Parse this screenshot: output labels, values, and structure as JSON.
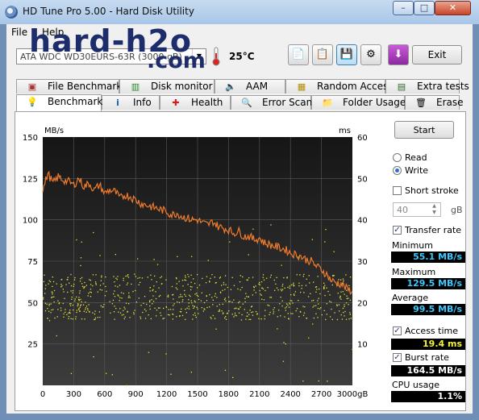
{
  "window": {
    "title": "HD Tune Pro 5.00 - Hard Disk Utility",
    "min_label": "–",
    "max_label": "□",
    "close_label": "✕"
  },
  "menu": {
    "file": "File",
    "help": "Help"
  },
  "watermark": {
    "line1": "hard-h2o",
    "line2": ".com"
  },
  "toolbar": {
    "drive": "ATA    WDC WD30EURS-63R (3000 gB)",
    "temperature": "25°C",
    "exit_label": "Exit",
    "icons": [
      "copy-icon",
      "copy-info-icon",
      "save-icon",
      "options-icon",
      "download-icon"
    ]
  },
  "tabs_top": [
    "File Benchmark",
    "Disk monitor",
    "AAM",
    "Random Access",
    "Extra tests"
  ],
  "tabs_bottom": [
    "Benchmark",
    "Info",
    "Health",
    "Error Scan",
    "Folder Usage",
    "Erase"
  ],
  "side": {
    "start_label": "Start",
    "read_label": "Read",
    "write_label": "Write",
    "mode_selected": "Write",
    "short_stroke_label": "Short stroke",
    "short_stroke_checked": false,
    "short_stroke_value": "40",
    "short_stroke_unit": "gB",
    "transfer_rate_label": "Transfer rate",
    "transfer_rate_checked": true,
    "minimum_label": "Minimum",
    "minimum": "55.1 MB/s",
    "maximum_label": "Maximum",
    "maximum": "129.5 MB/s",
    "average_label": "Average",
    "average": "99.5 MB/s",
    "access_time_label": "Access time",
    "access_time_checked": true,
    "access_time": "19.4 ms",
    "burst_rate_label": "Burst rate",
    "burst_rate_checked": true,
    "burst_rate": "164.5 MB/s",
    "cpu_label": "CPU usage",
    "cpu": "1.1%"
  },
  "colors": {
    "transfer_line": "#f07b2c",
    "access_points": "#e6e63a",
    "plot_bg_top": "#1a1a1a",
    "plot_bg_bottom": "#3a3a3a"
  },
  "chart_data": {
    "type": "line",
    "ylabel_left": "MB/s",
    "ylabel_right": "ms",
    "xlabel_suffix": "gB",
    "x_ticks": [
      "0",
      "300",
      "600",
      "900",
      "1200",
      "1500",
      "1800",
      "2100",
      "2400",
      "2700",
      "3000gB"
    ],
    "y_left_ticks": [
      "150",
      "125",
      "100",
      "75",
      "50",
      "25"
    ],
    "y_right_ticks": [
      "60",
      "50",
      "40",
      "30",
      "20",
      "10"
    ],
    "xlim": [
      0,
      3000
    ],
    "ylim_left": [
      0,
      150
    ],
    "ylim_right": [
      0,
      60
    ],
    "grid": true,
    "series": [
      {
        "kind": "transfer_rate_mb_s",
        "x": [
          0,
          50,
          100,
          150,
          200,
          250,
          300,
          350,
          400,
          450,
          500,
          550,
          600,
          650,
          700,
          750,
          800,
          850,
          900,
          950,
          1000,
          1050,
          1100,
          1150,
          1200,
          1250,
          1300,
          1350,
          1400,
          1450,
          1500,
          1550,
          1600,
          1650,
          1700,
          1750,
          1800,
          1850,
          1900,
          1950,
          2000,
          2050,
          2100,
          2150,
          2200,
          2250,
          2300,
          2350,
          2400,
          2450,
          2500,
          2550,
          2600,
          2650,
          2700,
          2750,
          2800,
          2850,
          2900,
          2950,
          3000
        ],
        "y": [
          118,
          128,
          122,
          126,
          124,
          123,
          121,
          125,
          120,
          122,
          118,
          121,
          116,
          118,
          117,
          113,
          115,
          114,
          112,
          110,
          109,
          108,
          107,
          106,
          105,
          103,
          104,
          102,
          101,
          100,
          100,
          98,
          97,
          99,
          96,
          95,
          94,
          92,
          93,
          90,
          90,
          88,
          89,
          86,
          85,
          84,
          83,
          82,
          80,
          79,
          78,
          76,
          75,
          72,
          70,
          67,
          63,
          62,
          61,
          58,
          57
        ]
      },
      {
        "kind": "access_time_ms",
        "x_range": [
          0,
          3000
        ],
        "y_band": [
          16,
          27
        ],
        "outlier_range": [
          0,
          40
        ]
      }
    ]
  }
}
